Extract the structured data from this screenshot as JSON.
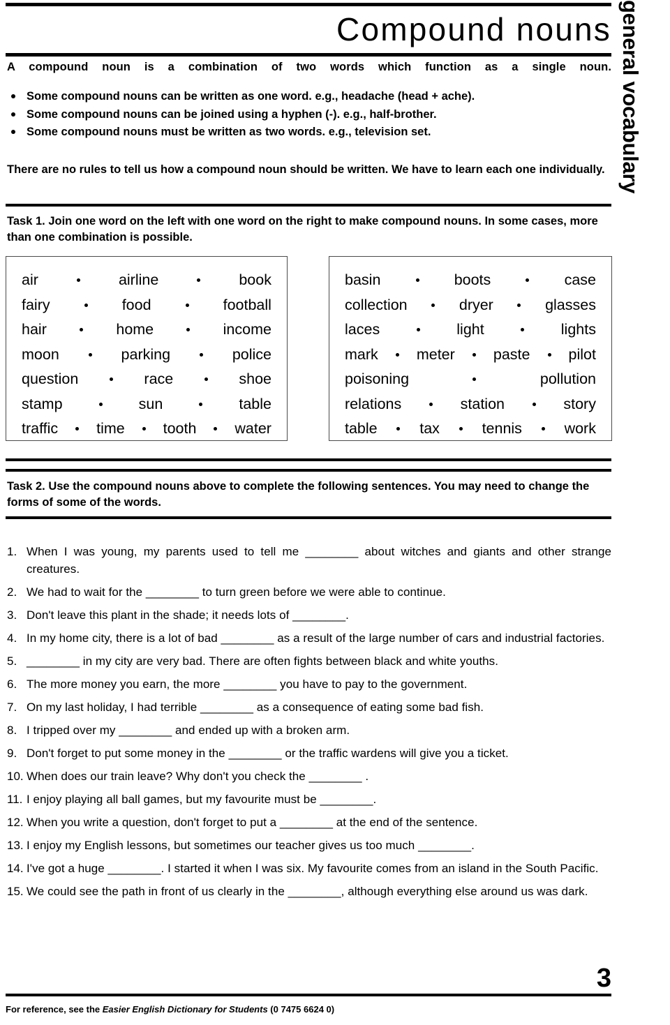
{
  "side_tab": {
    "label": "general vocabulary"
  },
  "title": "Compound nouns",
  "intro": {
    "lead": "A compound noun is a combination of two words which function as a single noun.",
    "bullets": [
      "Some compound nouns can be written as one word. e.g., headache (head + ache).",
      "Some compound nouns can be joined using a hyphen (-). e.g., half-brother.",
      "Some compound nouns must be written as two words. e.g., television set."
    ],
    "tail": "There are no rules to tell us how a compound noun should be written. We have to learn each one individually."
  },
  "task1": {
    "heading": "Task 1. Join one word on the left with one word on the right to make compound nouns. In some cases, more than one combination is possible.",
    "left_box": [
      [
        "air",
        "airline",
        "book"
      ],
      [
        "fairy",
        "food",
        "football"
      ],
      [
        "hair",
        "home",
        "income"
      ],
      [
        "moon",
        "parking",
        "police"
      ],
      [
        "question",
        "race",
        "shoe"
      ],
      [
        "stamp",
        "sun",
        "table"
      ],
      [
        "traffic",
        "time",
        "tooth",
        "water"
      ]
    ],
    "right_box": [
      [
        "basin",
        "boots",
        "case"
      ],
      [
        "collection",
        "dryer",
        "glasses"
      ],
      [
        "laces",
        "light",
        "lights"
      ],
      [
        "mark",
        "meter",
        "paste",
        "pilot"
      ],
      [
        "poisoning",
        "pollution"
      ],
      [
        "relations",
        "station",
        "story"
      ],
      [
        "table",
        "tax",
        "tennis",
        "work"
      ]
    ]
  },
  "task2": {
    "heading": "Task 2. Use the compound nouns above to complete the following sentences. You may need to change the forms of some of the words.",
    "questions": [
      {
        "num": "1.",
        "text": "When I was young, my parents used to tell me ________ about witches and giants and other strange creatures.",
        "justify": true
      },
      {
        "num": "2.",
        "text": "We had to wait for the ________ to turn green before we were able to continue.",
        "justify": false
      },
      {
        "num": "3.",
        "text": "Don't leave this plant in the shade; it needs lots of ________.",
        "justify": false
      },
      {
        "num": "4.",
        "text": "In my home city, there is a lot of bad ________ as a result of the large number of cars and industrial factories.",
        "justify": true
      },
      {
        "num": "5.",
        "text": "________ in my city are very bad. There are often fights between black and white youths.",
        "justify": false
      },
      {
        "num": "6.",
        "text": "The more money you earn, the more ________ you have to pay to the government.",
        "justify": false
      },
      {
        "num": "7.",
        "text": "On my last holiday, I had terrible ________  as a consequence of eating some bad fish.",
        "justify": false
      },
      {
        "num": "8.",
        "text": "I tripped over my  ________ and ended up with a broken arm.",
        "justify": false
      },
      {
        "num": "9.",
        "text": "Don't forget to put some money in the ________ or the traffic wardens will give you a ticket.",
        "justify": true
      },
      {
        "num": "10.",
        "text": "When does our train leave? Why don't you check the ________ .",
        "justify": false
      },
      {
        "num": "11.",
        "text": "I enjoy playing all ball games, but my favourite must be  ________.",
        "justify": false
      },
      {
        "num": "12.",
        "text": "When you write a question, don't forget to put a ________ at the end of the sentence.",
        "justify": false
      },
      {
        "num": "13.",
        "text": "I enjoy my English lessons, but sometimes our teacher gives us too much ________.",
        "justify": false
      },
      {
        "num": "14.",
        "text": "I've got a huge ________. I started it when I was six. My favourite comes from an island in the South Pacific.",
        "justify": true
      },
      {
        "num": "15.",
        "text": "We could see the path in front of us clearly in the ________, although everything else around us was dark.",
        "justify": true
      }
    ]
  },
  "footer": {
    "prefix": "For reference, see the ",
    "italic": "Easier English Dictionary for Students",
    "suffix": " (0 7475 6624 0)",
    "page_number": "3"
  }
}
